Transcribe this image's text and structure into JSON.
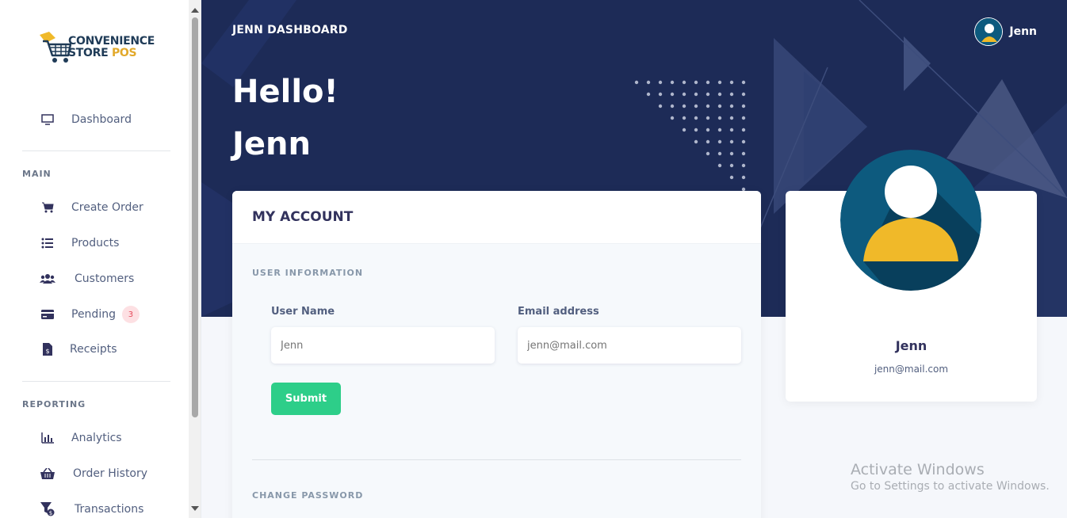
{
  "brand": {
    "line1": "CONVENIENCE",
    "line2": "STORE",
    "line2_accent": "POS"
  },
  "sidebar": {
    "dashboard": "Dashboard",
    "main_heading": "MAIN",
    "create_order": "Create Order",
    "products": "Products",
    "customers": "Customers",
    "pending": "Pending",
    "pending_count": "3",
    "receipts": "Receipts",
    "reporting_heading": "REPORTING",
    "analytics": "Analytics",
    "order_history": "Order History",
    "transactions": "Transactions"
  },
  "header": {
    "title": "JENN DASHBOARD",
    "user": "Jenn",
    "greeting": "Hello!",
    "greeting_name": "Jenn"
  },
  "account": {
    "title": "MY ACCOUNT",
    "user_info_heading": "USER INFORMATION",
    "username_label": "User Name",
    "username_placeholder": "Jenn",
    "email_label": "Email address",
    "email_placeholder": "jenn@mail.com",
    "submit_label": "Submit",
    "change_password_heading": "CHANGE PASSWORD"
  },
  "profile": {
    "name": "Jenn",
    "email": "jenn@mail.com"
  },
  "watermark": {
    "line1": "Activate Windows",
    "line2": "Go to Settings to activate Windows."
  },
  "colors": {
    "hero": "#1d2b57",
    "submit": "#2dce89",
    "avatar_bg": "#0d5a7e",
    "avatar_body": "#f0b929",
    "badge": "#fde0e3"
  }
}
